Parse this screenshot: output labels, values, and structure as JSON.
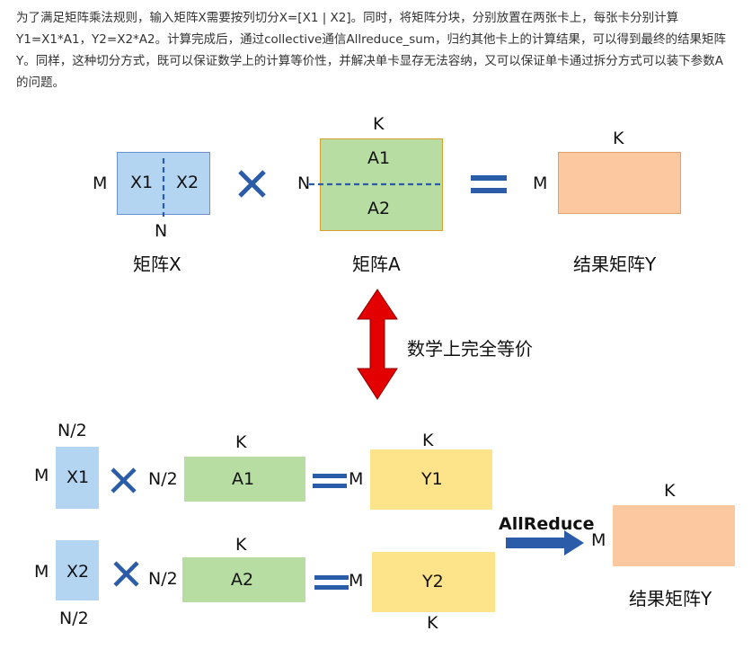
{
  "paragraph": "为了满足矩阵乘法规则，输入矩阵X需要按列切分X=[X1 | X2]。同时，将矩阵分块，分别放置在两张卡上，每张卡分别计算Y1=X1*A1，Y2=X2*A2。计算完成后，通过collective通信Allreduce_sum，归约其他卡上的计算结果，可以得到最终的结果矩阵Y。同样，这种切分方式，既可以保证数学上的计算等价性，并解决单卡显存无法容纳，又可以保证单卡通过拆分方式可以装下参数A的问题。",
  "colors": {
    "blue_fill": "#b4d5f2",
    "green_fill": "#b8dda3",
    "salmon_fill": "#fcc8a0",
    "yellow_fill": "#fde48a",
    "operator_blue": "#2a5caa",
    "arrow_red": "#e30000"
  },
  "top": {
    "x_matrix": {
      "row_label": "M",
      "col_label": "N",
      "left": "X1",
      "right": "X2",
      "caption": "矩阵X"
    },
    "times": "×",
    "a_matrix": {
      "row_label": "N",
      "col_label": "K",
      "top": "A1",
      "bottom": "A2",
      "caption": "矩阵A"
    },
    "equals": "=",
    "y_matrix": {
      "row_label": "M",
      "col_label": "K",
      "caption": "结果矩阵Y"
    }
  },
  "equivalence_text": "数学上完全等价",
  "bottom": {
    "row1": {
      "x_col_label": "N/2",
      "x_row_label": "M",
      "x_label": "X1",
      "a_row_label": "N/2",
      "a_col_label": "K",
      "a_label": "A1",
      "y_row_label": "M",
      "y_col_label": "K",
      "y_label": "Y1"
    },
    "row2": {
      "x_col_label": "N/2",
      "x_row_label": "M",
      "x_label": "X2",
      "a_row_label": "N/2",
      "a_col_label": "K",
      "a_label": "A2",
      "y_row_label": "M",
      "y_col_label": "K",
      "y_label": "Y2"
    },
    "allreduce_label": "AllReduce",
    "result": {
      "row_label": "M",
      "col_label": "K",
      "caption": "结果矩阵Y"
    }
  }
}
